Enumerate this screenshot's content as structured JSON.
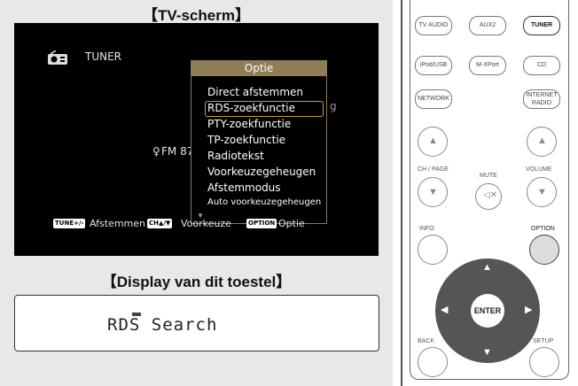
{
  "titles": {
    "tv": "【TV-scherm】",
    "display": "【Display van dit toestel】"
  },
  "tv": {
    "source": "TUNER",
    "band_partial": "FM 87",
    "side_partial": "g",
    "menu": {
      "title": "Optie",
      "items": [
        "Direct afstemmen",
        "RDS-zoekfunctie",
        "PTY-zoekfunctie",
        "TP-zoekfunctie",
        "Radiotekst",
        "Voorkeuzegeheugen",
        "Afstemmodus",
        "Auto voorkeuzegeheugen"
      ],
      "selected_index": 1
    },
    "footer": {
      "key1": "TUNE+/-",
      "label1": "Afstemmen",
      "key2": "CH▲/▼",
      "label2": "Voorkeuze",
      "key3": "OPTION",
      "label3": "Optie"
    }
  },
  "display": {
    "text": "RDS Search"
  },
  "remote": {
    "buttons": [
      "TV AUDIO",
      "AUX2",
      "TUNER",
      "iPod/USB",
      "M-XPort",
      "CD",
      "NETWORK",
      "INTERNET RADIO"
    ],
    "labels": {
      "ch_page": "CH / PAGE",
      "mute": "MUTE",
      "volume": "VOLUME",
      "info": "INFO",
      "option": "OPTION",
      "back": "BACK",
      "setup": "SETUP",
      "enter": "ENTER"
    }
  }
}
